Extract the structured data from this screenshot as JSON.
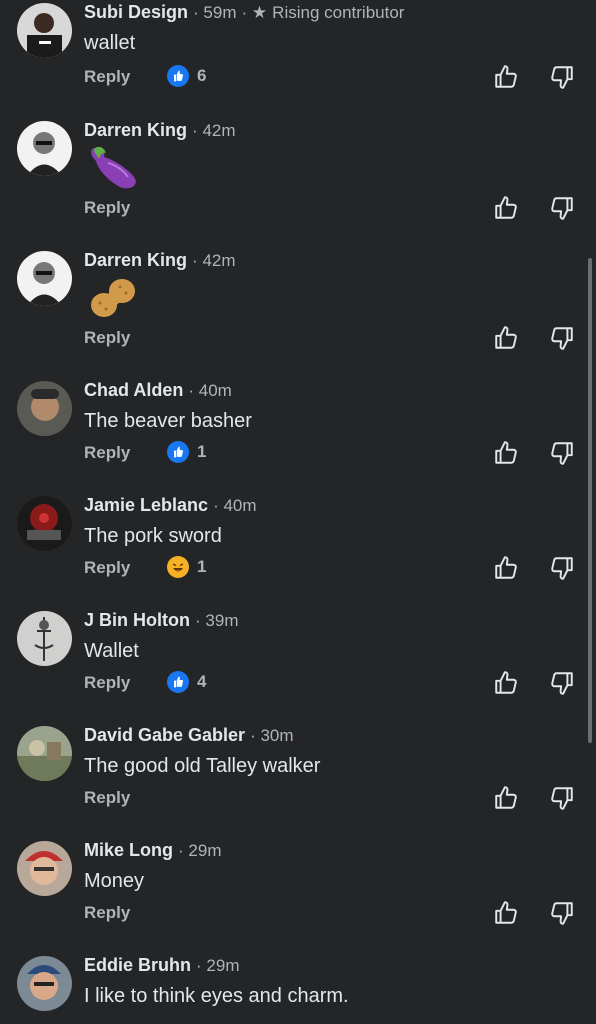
{
  "labels": {
    "reply": "Reply"
  },
  "comments": [
    {
      "name": "Subi Design",
      "time": "59m",
      "badge": "Rising contributor",
      "text": "wallet",
      "reaction": "like",
      "reaction_count": "6"
    },
    {
      "name": "Darren King",
      "time": "42m",
      "emoji": "eggplant-emoji"
    },
    {
      "name": "Darren King",
      "time": "42m",
      "emoji": "peanut-emoji"
    },
    {
      "name": "Chad Alden",
      "time": "40m",
      "text": "The beaver basher",
      "reaction": "like",
      "reaction_count": "1"
    },
    {
      "name": "Jamie Leblanc",
      "time": "40m",
      "text": "The pork sword",
      "reaction": "haha",
      "reaction_count": "1"
    },
    {
      "name": "J Bin Holton",
      "time": "39m",
      "text": "Wallet",
      "reaction": "like",
      "reaction_count": "4"
    },
    {
      "name": "David Gabe Gabler",
      "time": "30m",
      "text": "The good old Talley walker"
    },
    {
      "name": "Mike Long",
      "time": "29m",
      "text": "Money"
    },
    {
      "name": "Eddie Bruhn",
      "time": "29m",
      "text": "I like to think eyes and charm."
    }
  ],
  "colors": {
    "background": "#242526",
    "primary_text": "#e4e6eb",
    "secondary_text": "#b0b3b8",
    "like_blue": "#1877f2",
    "haha_yellow": "#f7b125"
  }
}
